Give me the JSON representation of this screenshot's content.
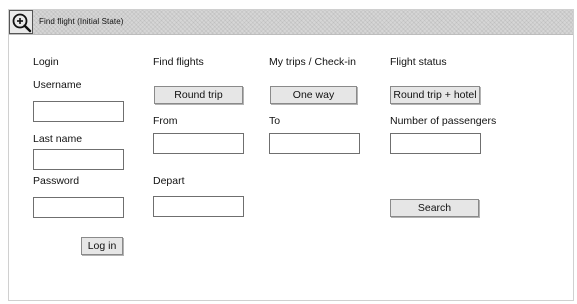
{
  "window": {
    "title": "Find flight   (Initial State)"
  },
  "columns": {
    "login": {
      "heading": "Login",
      "username_label": "Username",
      "username_value": "",
      "lastname_label": "Last name",
      "lastname_value": "",
      "password_label": "Password",
      "password_value": "",
      "login_button": "Log in"
    },
    "find_flights": {
      "heading": "Find flights",
      "round_trip_button": "Round trip",
      "from_label": "From",
      "from_value": "",
      "depart_label": "Depart",
      "depart_value": ""
    },
    "my_trips": {
      "heading": "My trips / Check-in",
      "one_way_button": "One way",
      "to_label": "To",
      "to_value": ""
    },
    "flight_status": {
      "heading": "Flight status",
      "round_trip_hotel_button": "Round trip + hotel",
      "passengers_label": "Number of passengers",
      "passengers_value": "",
      "search_button": "Search"
    }
  }
}
